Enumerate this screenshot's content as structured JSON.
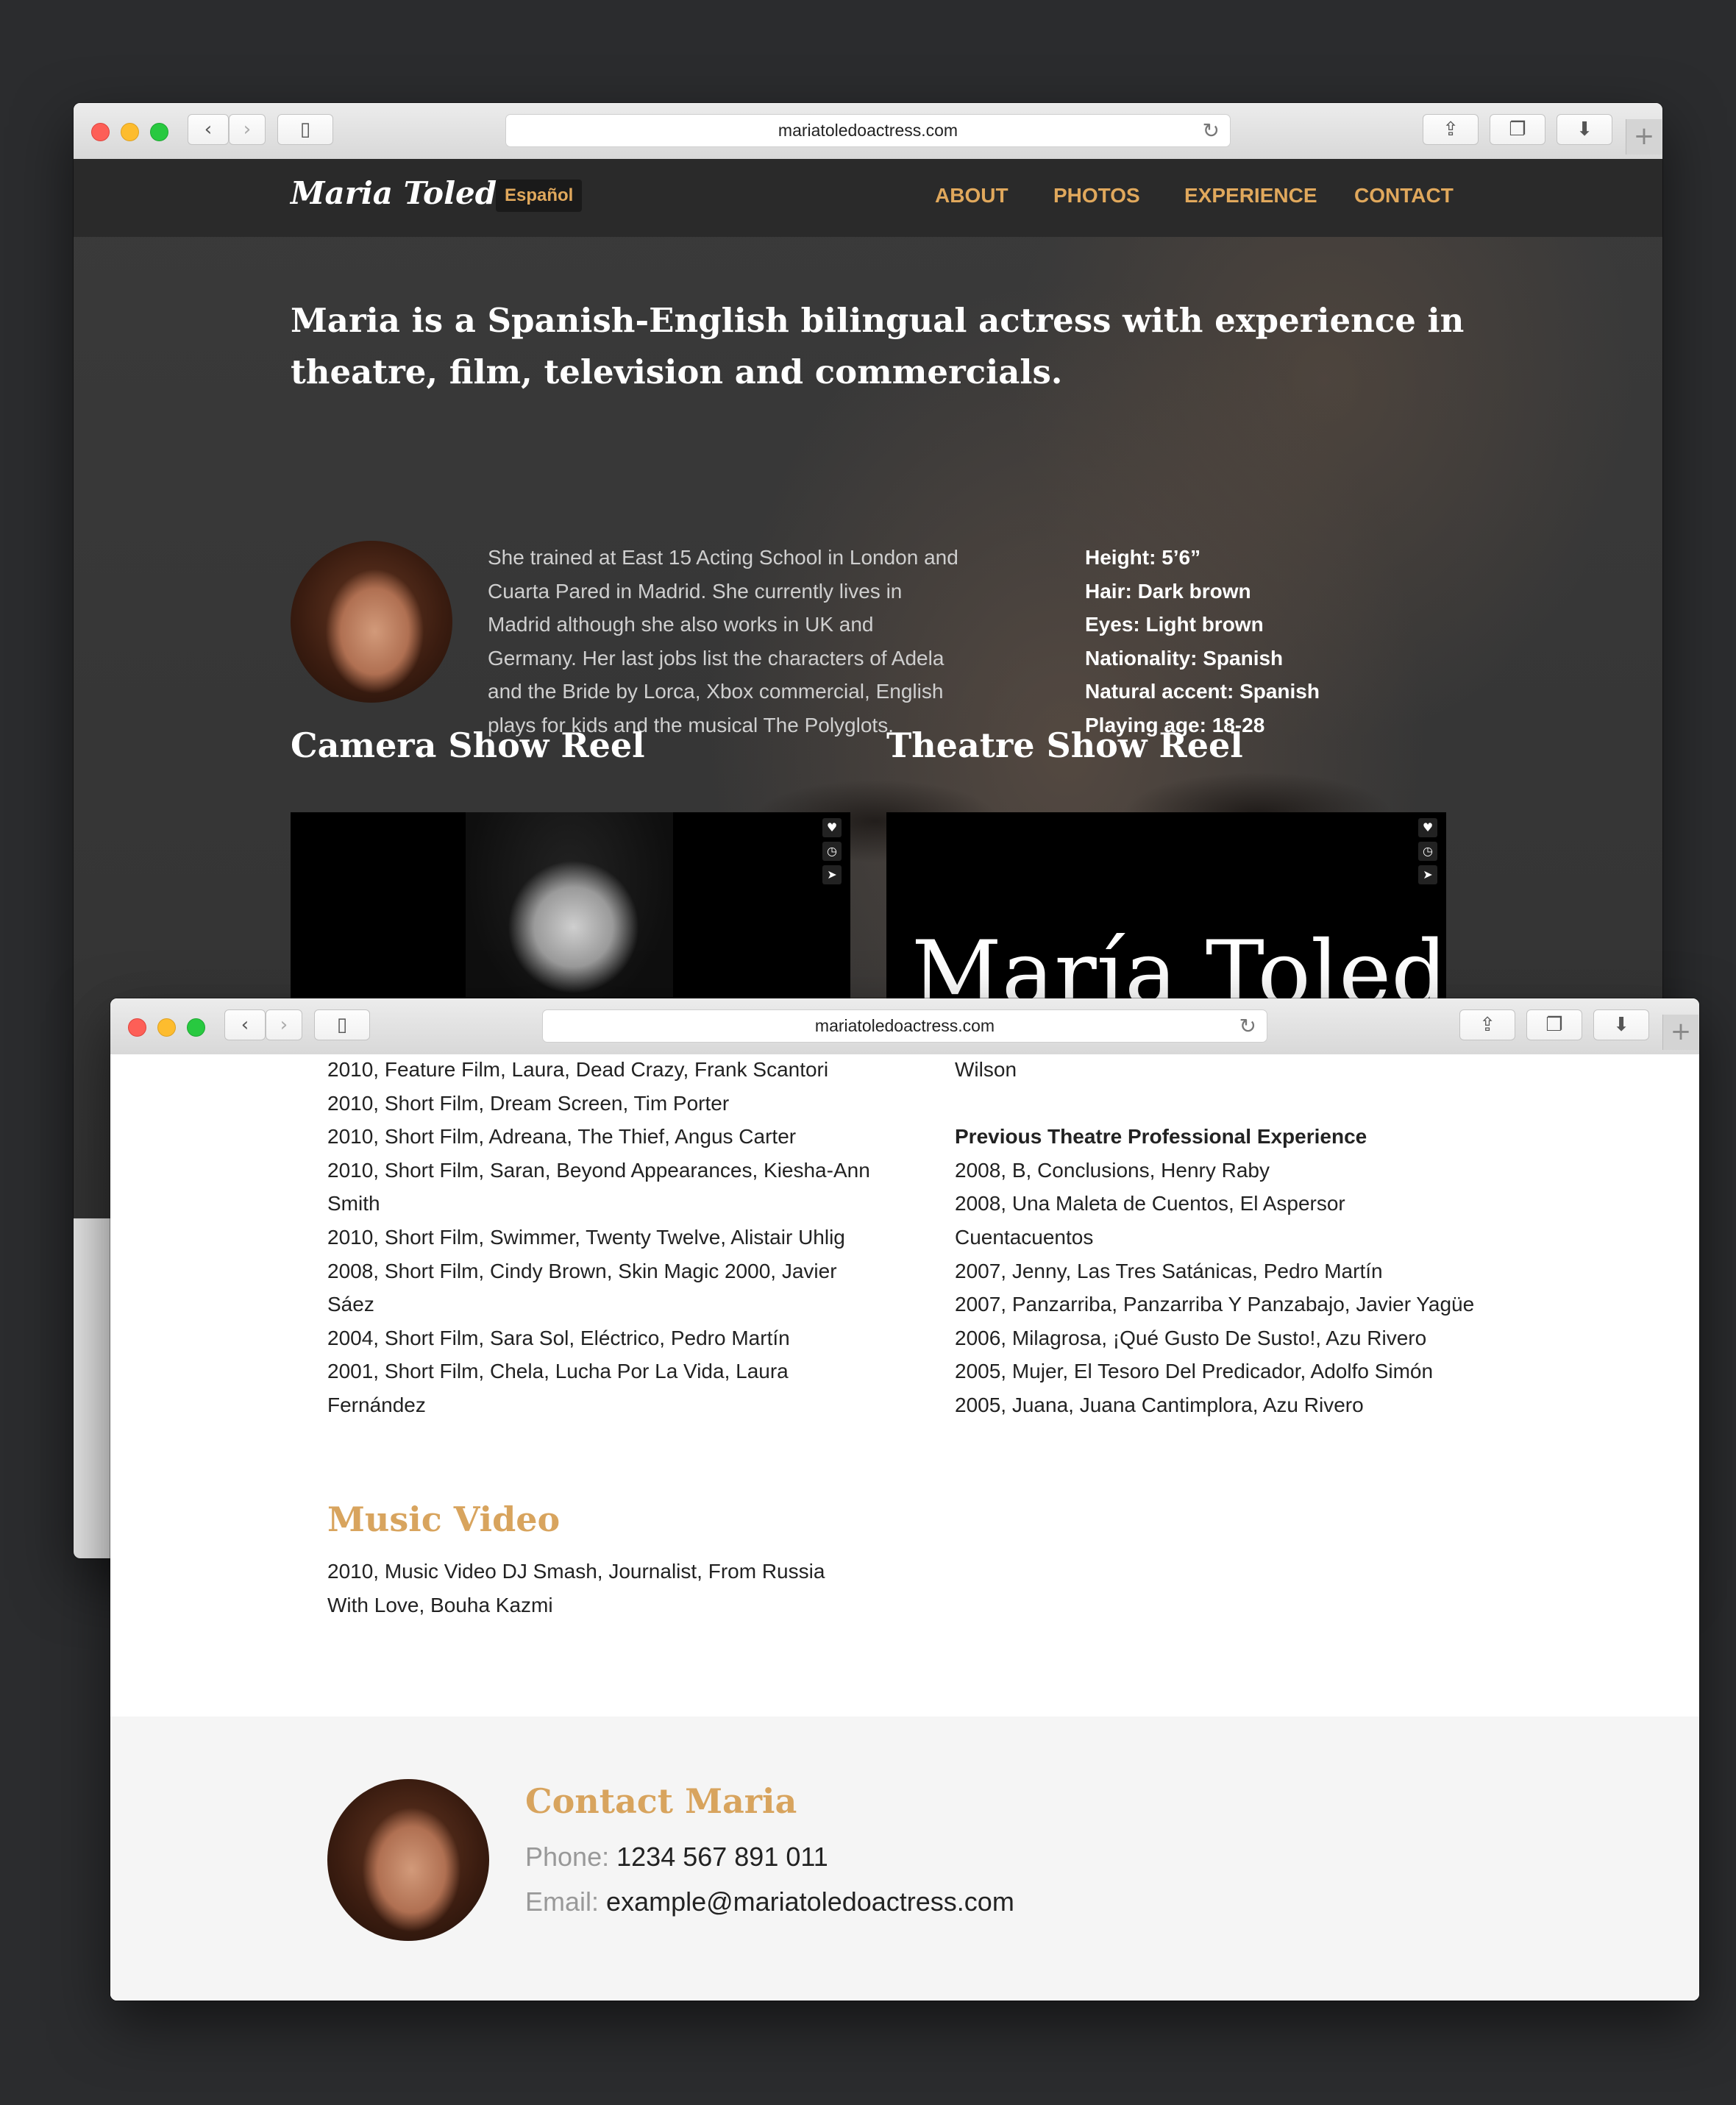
{
  "browser": {
    "url_top": "mariatoledoactress.com",
    "url_bottom": "mariatoledoactress.com"
  },
  "site": {
    "logo": "Maria Toledo",
    "language_toggle": "Español",
    "nav": [
      "ABOUT",
      "PHOTOS",
      "EXPERIENCE",
      "CONTACT"
    ],
    "accent_color": "#e0a85c"
  },
  "hero": {
    "intro": "Maria is a Spanish-English bilingual actress with experience in theatre, film, television and commercials.",
    "bio": "She trained at East 15 Acting School in London and Cuarta Pared in Madrid. She currently lives in Madrid although she also works in UK and Germany. Her last jobs list the characters of Adela and the Bride by Lorca, Xbox commercial, English plays for kids and the musical The Polyglots.",
    "stats": [
      "Height: 5’6”",
      "Hair: Dark brown",
      "Eyes: Light brown",
      "Nationality: Spanish",
      "Natural accent: Spanish",
      "Playing age: 18-28"
    ]
  },
  "reels": {
    "camera_title": "Camera Show Reel",
    "theatre_title": "Theatre Show Reel",
    "theatre_video_text": "María Toledo",
    "video_icons": [
      "heart-icon",
      "clock-icon",
      "send-icon"
    ]
  },
  "experience": {
    "film_items": [
      "2010, Feature Film, Laura, Dead Crazy, Frank Scantori",
      "2010, Short Film, Dream Screen, Tim Porter",
      "2010, Short Film, Adreana, The Thief, Angus Carter",
      "2010, Short Film, Saran, Beyond Appearances, Kiesha-Ann Smith",
      "2010, Short Film, Swimmer, Twenty Twelve, Alistair Uhlig",
      "2008, Short Film, Cindy Brown, Skin Magic 2000, Javier Sáez",
      "2004, Short Film, Sara Sol, Eléctrico, Pedro Martín",
      "2001, Short Film, Chela, Lucha Por La Vida, Laura Fernández"
    ],
    "music_video_title": "Music Video",
    "music_video_items": [
      "2010, Music Video DJ Smash, Journalist, From Russia With Love, Bouha Kazmi"
    ],
    "right_top_text": "Wilson",
    "theatre_heading": "Previous Theatre Professional Experience",
    "theatre_items": [
      "2008, B, Conclusions, Henry Raby",
      "2008, Una Maleta de Cuentos, El Aspersor Cuentacuentos",
      "2007, Jenny, Las Tres Satánicas, Pedro Martín",
      "2007, Panzarriba, Panzarriba Y Panzabajo, Javier Yagüe",
      "2006, Milagrosa, ¡Qué Gusto De Susto!, Azu Rivero",
      "2005, Mujer, El Tesoro Del Predicador, Adolfo Simón",
      "2005, Juana, Juana Cantimplora, Azu Rivero"
    ]
  },
  "contact": {
    "title": "Contact Maria",
    "phone_label": "Phone:",
    "phone": "1234 567 891 011",
    "email_label": "Email:",
    "email": "example@mariatoledoactress.com"
  }
}
